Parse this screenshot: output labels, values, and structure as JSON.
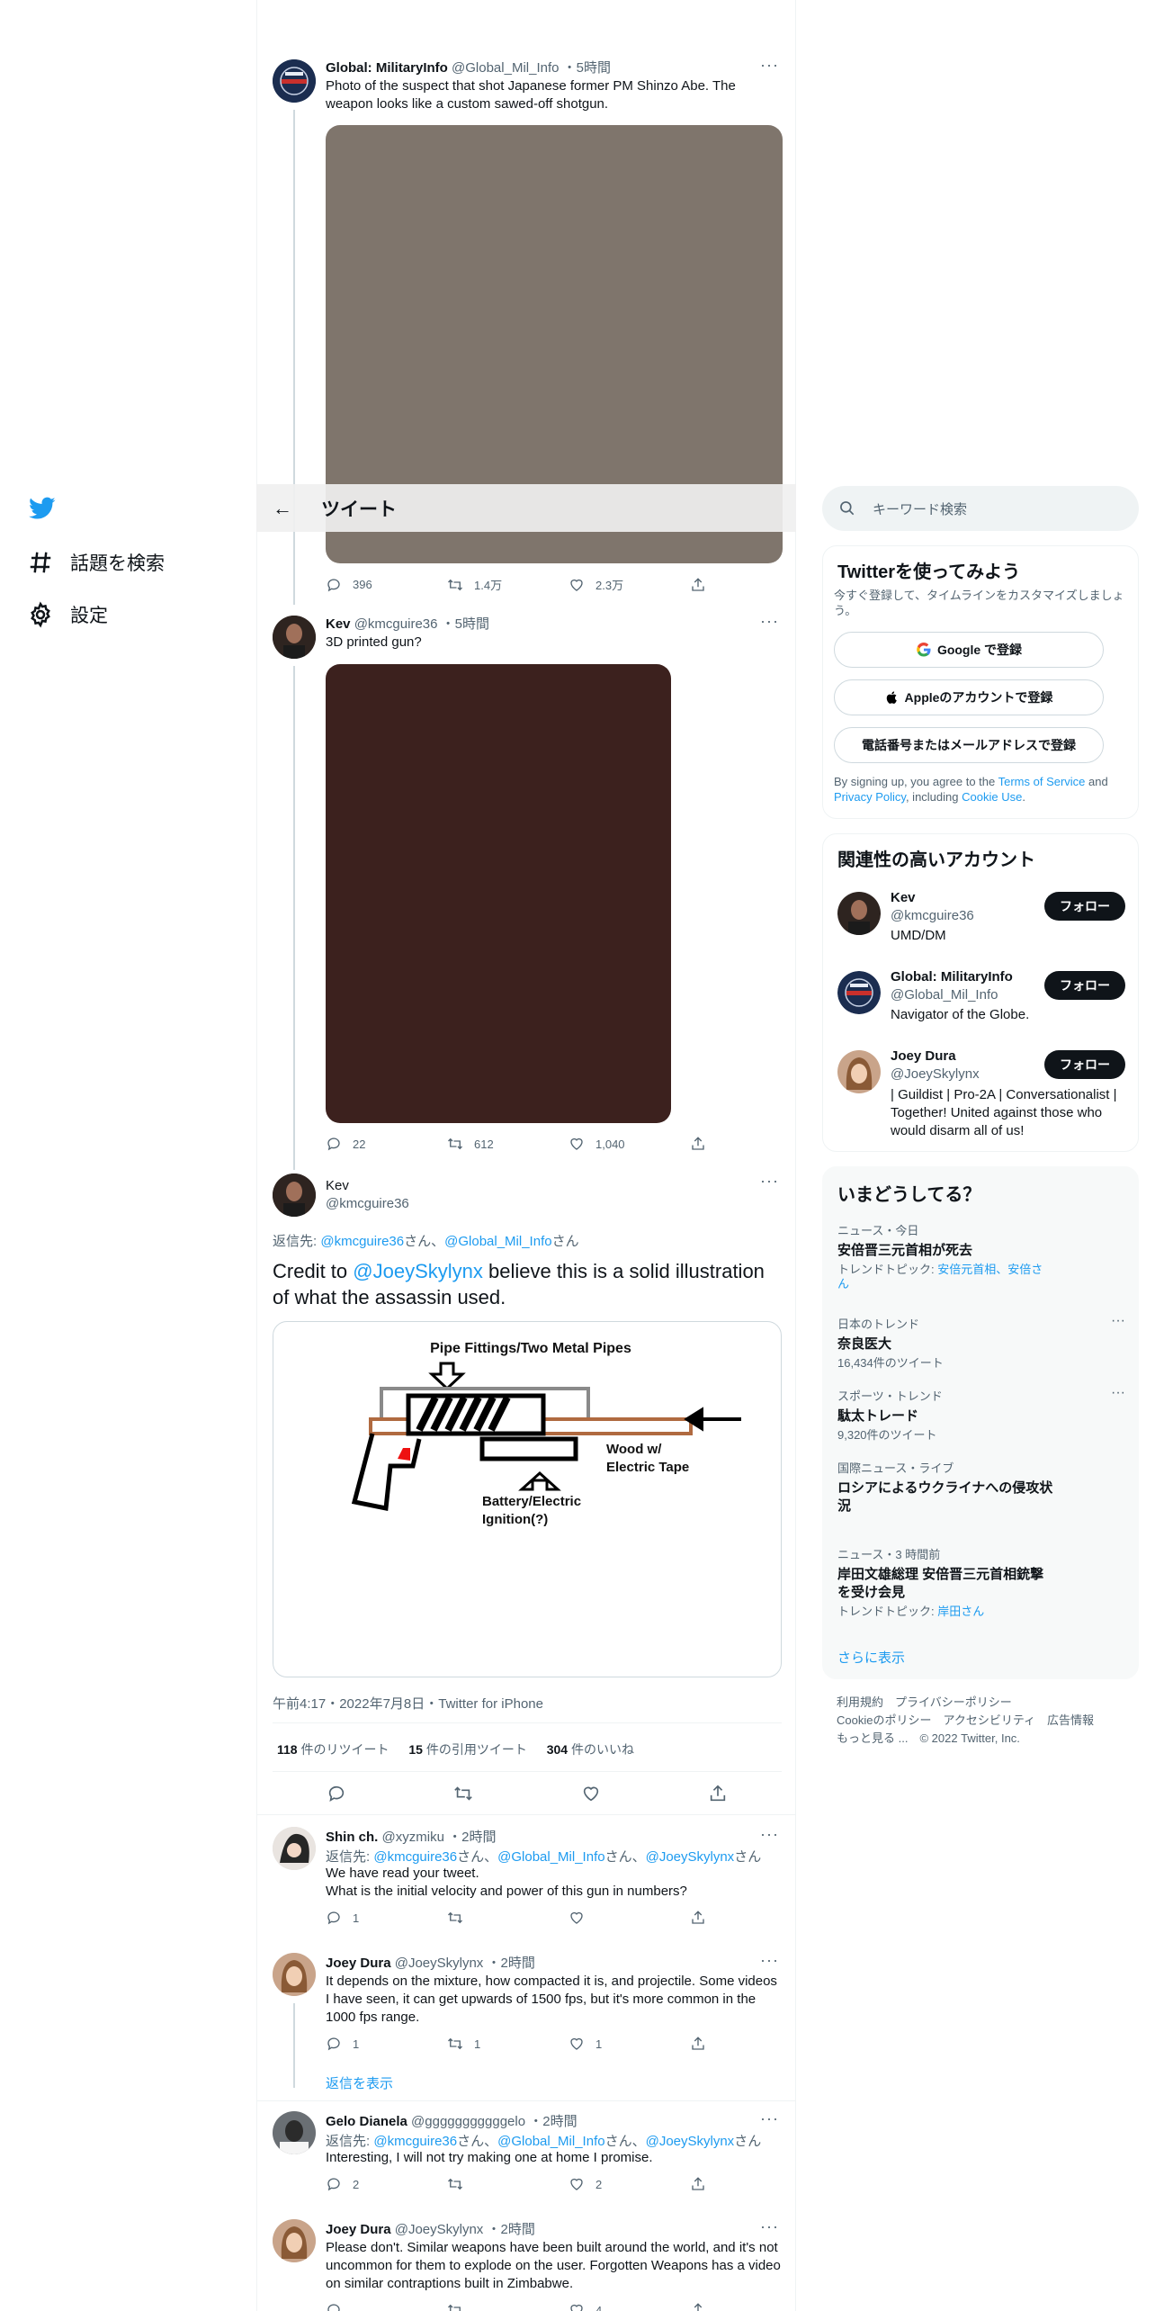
{
  "nav": {
    "items": [
      {
        "label": "話題を検索",
        "icon": "hashtag-icon"
      },
      {
        "label": "設定",
        "icon": "gear-icon"
      }
    ]
  },
  "header": {
    "title": "ツイート"
  },
  "tweets": [
    {
      "name": "Global: MilitaryInfo",
      "handle": "@Global_Mil_Info",
      "time": "5時間",
      "text": "Photo of the suspect that shot Japanese former PM Shinzo Abe. The weapon looks like a custom sawed-off shotgun.",
      "image_color": "#7f756c",
      "replies": "396",
      "retweets": "1.4万",
      "likes": "2.3万"
    },
    {
      "name": "Kev",
      "handle": "@kmcguire36",
      "time": "5時間",
      "text": "3D printed gun?",
      "image_color": "#3c211e",
      "replies": "22",
      "retweets": "612",
      "likes": "1,040"
    }
  ],
  "main": {
    "name": "Kev",
    "handle": "@kmcguire36",
    "reply_prefix": "返信先: ",
    "reply_mention1": "@kmcguire36",
    "reply_mid": "さん、",
    "reply_mention2": "@Global_Mil_Info",
    "reply_suffix": "さん",
    "text_pre": "Credit to ",
    "text_mention": "@JoeySkylynx",
    "text_post": " believe this is a solid illustration of what the assassin used.",
    "diagram": {
      "label_top": "Pipe Fittings/Two Metal Pipes",
      "label_right1": "Wood w/",
      "label_right2": "Electric Tape",
      "label_bottom1": "Battery/Electric",
      "label_bottom2": "Ignition(?)"
    },
    "meta": "午前4:17・2022年7月8日・Twitter for iPhone",
    "retweets_count": "118",
    "retweets_label": " 件のリツイート",
    "quotes_count": "15",
    "quotes_label": " 件の引用ツイート",
    "likes_count": "304",
    "likes_label": " 件のいいね"
  },
  "replies": [
    {
      "name": "Shin ch.",
      "handle": "@xyzmiku",
      "time": "2時間",
      "reply_to": [
        "@kmcguire36",
        "@Global_Mil_Info",
        "@JoeySkylynx"
      ],
      "text1": "We have read your tweet.",
      "text2": "What is the initial velocity and power of this gun in numbers?",
      "replies": "1",
      "retweets": "",
      "likes": ""
    },
    {
      "name": "Joey Dura",
      "handle": "@JoeySkylynx",
      "time": "2時間",
      "text": "It depends on the mixture, how compacted it is, and projectile. Some videos I have seen, it can get upwards of 1500 fps, but it's more common in the 1000 fps range.",
      "replies": "1",
      "retweets": "1",
      "likes": "1"
    },
    {
      "name": "Gelo Dianela",
      "handle": "@gggggggggggelo",
      "time": "2時間",
      "reply_to": [
        "@kmcguire36",
        "@Global_Mil_Info",
        "@JoeySkylynx"
      ],
      "text": "Interesting, I will not try making one at home I promise.",
      "replies": "2",
      "retweets": "",
      "likes": "2"
    },
    {
      "name": "Joey Dura",
      "handle": "@JoeySkylynx",
      "time": "2時間",
      "text": "Please don't. Similar weapons have been built around the world, and it's not uncommon for them to explode on the user. Forgotten Weapons has a video on similar contraptions built in Zimbabwe.",
      "replies": "",
      "retweets": "",
      "likes": "4"
    }
  ],
  "show_replies": "返信を表示",
  "reply_to_prefix": "返信先: ",
  "reply_to_san": "さん",
  "reply_to_sep": "さん、",
  "sidebar": {
    "search_placeholder": "キーワード検索",
    "signup": {
      "title": "Twitterを使ってみよう",
      "subtitle": "今すぐ登録して、タイムラインをカスタマイズしましょう。",
      "google": "Google で登録",
      "apple": "Appleのアカウントで登録",
      "phone": "電話番号またはメールアドレスで登録",
      "legal_pre": "By signing up, you agree to the ",
      "terms": "Terms of Service",
      "legal_and": " and ",
      "privacy": "Privacy Policy",
      "legal_including": ", including ",
      "cookie": "Cookie Use",
      "legal_end": "."
    },
    "related": {
      "title": "関連性の高いアカウント",
      "follow_label": "フォロー",
      "accounts": [
        {
          "name": "Kev",
          "handle": "@kmcguire36",
          "bio": "UMD/DM"
        },
        {
          "name": "Global: MilitaryInfo",
          "handle": "@Global_Mil_Info",
          "bio": "Navigator of the Globe."
        },
        {
          "name": "Joey Dura",
          "handle": "@JoeySkylynx",
          "bio": "| Guildist | Pro-2A | Conversationalist | Together! United against those who would disarm all of us!"
        }
      ]
    },
    "trends": {
      "title": "いまどうしてる？",
      "items": [
        {
          "cat": "ニュース・今日",
          "name": "安倍晋三元首相が死去",
          "sub_prefix": "トレンドトピック: ",
          "sub_link": "安倍元首相、安倍さん"
        },
        {
          "cat": "日本のトレンド",
          "name": "奈良医大",
          "sub": "16,434件のツイート"
        },
        {
          "cat": "スポーツ・トレンド",
          "name": "駄太トレード",
          "sub": "9,320件のツイート"
        },
        {
          "cat": "国際ニュース・ライブ",
          "name": "ロシアによるウクライナへの侵攻状況"
        },
        {
          "cat": "ニュース・3 時間前",
          "name": "岸田文雄総理 安倍晋三元首相銃撃を受け会見",
          "sub_prefix": "トレンドトピック: ",
          "sub_link": "岸田さん"
        }
      ],
      "show_more": "さらに表示"
    },
    "footer": {
      "line1": "利用規約　プライバシーポリシー",
      "line2": "Cookieのポリシー　アクセシビリティ　広告情報",
      "line3": "もっと見る ...　© 2022 Twitter, Inc."
    }
  }
}
